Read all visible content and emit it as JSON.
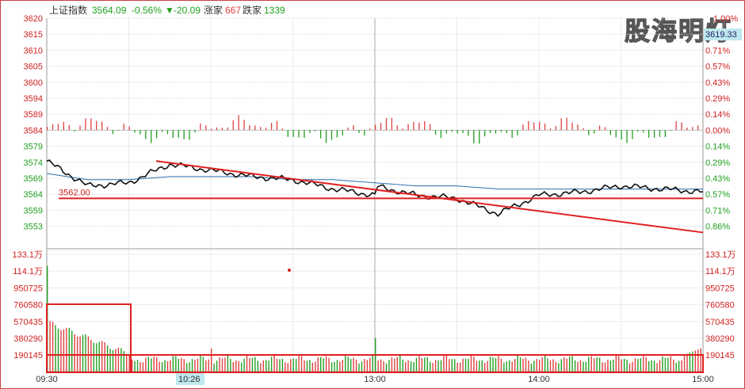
{
  "watermark": "股海明灯",
  "header": {
    "index_name": "上证指数",
    "price": "3564.09",
    "change_pct": "-0.56%",
    "change_arrow": "▼",
    "change_abs": "-20.09",
    "up_label": "涨家",
    "up_count": "667",
    "down_label": "跌家",
    "down_count": "1339"
  },
  "price_axis": {
    "left_labels": [
      "3620",
      "3615",
      "3610",
      "3605",
      "3600",
      "3594",
      "3589",
      "3584",
      "3579",
      "3574",
      "3569",
      "3564",
      "3559",
      "3553"
    ],
    "right_labels": [
      "1.00%",
      "0.86%",
      "0.71%",
      "0.57%",
      "0.43%",
      "0.29%",
      "0.14%",
      "0.00%",
      "0.14%",
      "0.29%",
      "0.43%",
      "0.57%",
      "0.71%",
      "0.86%"
    ],
    "current_value_box": "3619.33",
    "baseline": 3584
  },
  "volume_axis": {
    "labels": [
      "133.1万",
      "114.1万",
      "950725",
      "760580",
      "570435",
      "380290",
      "190145"
    ]
  },
  "time_axis": {
    "labels": [
      "09:30",
      "10:26",
      "13:00",
      "14:00",
      "15:00"
    ],
    "cursor_label": "10:26"
  },
  "annotations": {
    "support_label": "3562.00",
    "support_value": 3562.0
  },
  "colors": {
    "up": "#e04040",
    "down": "#20a020",
    "price_line": "#000000",
    "avg_line": "#2a6fb0",
    "annotation": "#e02020",
    "grid": "#d8d8d8"
  },
  "chart_data": {
    "type": "line",
    "x": [
      "09:30",
      "09:45",
      "10:00",
      "10:15",
      "10:30",
      "10:45",
      "11:00",
      "11:15",
      "11:30",
      "13:00",
      "13:15",
      "13:30",
      "13:45",
      "14:00",
      "14:15",
      "14:30",
      "14:45",
      "15:00"
    ],
    "series": [
      {
        "values": [
          3574,
          3566,
          3567,
          3573,
          3571,
          3569,
          3568,
          3565,
          3563,
          3566,
          3563,
          3562,
          3557,
          3563,
          3564,
          3566,
          3565,
          3564.09
        ]
      },
      {
        "values": [
          3570,
          3568,
          3568,
          3569,
          3569,
          3569,
          3568,
          3568,
          3567,
          3567,
          3566,
          3566,
          3565,
          3565,
          3565,
          3565,
          3565,
          3565
        ]
      }
    ],
    "trendline": {
      "from": [
        "10:10",
        3574
      ],
      "to": [
        "15:00",
        3551
      ]
    },
    "support_line": 3562,
    "ylim": [
      3553,
      3620
    ],
    "volume_ylim": [
      0,
      1331000
    ]
  }
}
